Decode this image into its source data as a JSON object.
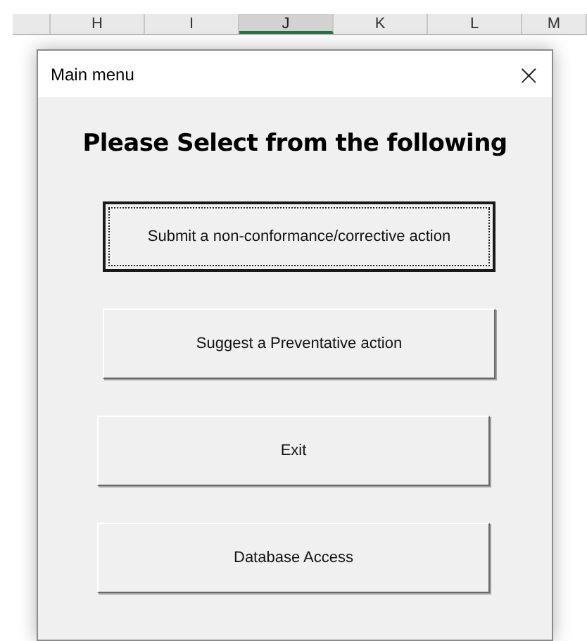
{
  "columns": [
    {
      "label": "H",
      "selected": false
    },
    {
      "label": "I",
      "selected": false
    },
    {
      "label": "J",
      "selected": true
    },
    {
      "label": "K",
      "selected": false
    },
    {
      "label": "L",
      "selected": false
    },
    {
      "label": "M",
      "selected": false
    }
  ],
  "window": {
    "title": "Main menu",
    "close": "×"
  },
  "heading": "Please Select from the following",
  "buttons": [
    {
      "label": "Submit a non-conformance/corrective action",
      "focused": true
    },
    {
      "label": "Suggest a Preventative action",
      "focused": false
    },
    {
      "label": "Exit",
      "focused": false
    },
    {
      "label": "Database Access",
      "focused": false
    }
  ]
}
